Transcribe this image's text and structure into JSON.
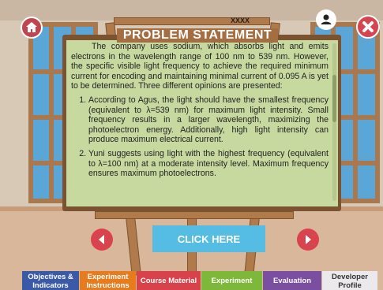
{
  "header": {
    "small_title": "XXXX",
    "problem_title": "PROBLEM STATEMENT"
  },
  "icons": {
    "home": "home-icon",
    "user": "user-icon",
    "close": "close-icon",
    "prev": "arrow-left-icon",
    "next": "arrow-right-icon"
  },
  "problem": {
    "intro": "The company uses sodium, which absorbs light and emits electrons in the wavelength range of 100 nm to 539 nm. However, the specific visible light frequency to achieve the required minimum current for encoding and maintaining minimal current of 0.095 A is yet to be determined. Three different opinions are presented:",
    "opinions": [
      "According to Agus, the light should have the smallest frequency (equivalent to λ=539 nm) for maximum light intensity. Small frequency results in a larger wavelength, maximizing the photoelectron energy. Additionally, high light intensity can produce maximum electrical current.",
      "Yuni suggests using light with the highest frequency (equivalent to λ=100 nm) at a moderate intensity level. Maximum frequency ensures maximum photoelectrons."
    ]
  },
  "actions": {
    "click_here": "CLICK HERE"
  },
  "tabs": [
    {
      "label": "Objectives & Indicators",
      "color": "#3a5aa8"
    },
    {
      "label": "Experiment Instructions",
      "color": "#e77c1f"
    },
    {
      "label": "Course Material",
      "color": "#d8424b"
    },
    {
      "label": "Experiment",
      "color": "#7db83a"
    },
    {
      "label": "Evaluation",
      "color": "#7a4fa0"
    },
    {
      "label": "Developer Profile",
      "color": "#ebe9ec"
    }
  ]
}
